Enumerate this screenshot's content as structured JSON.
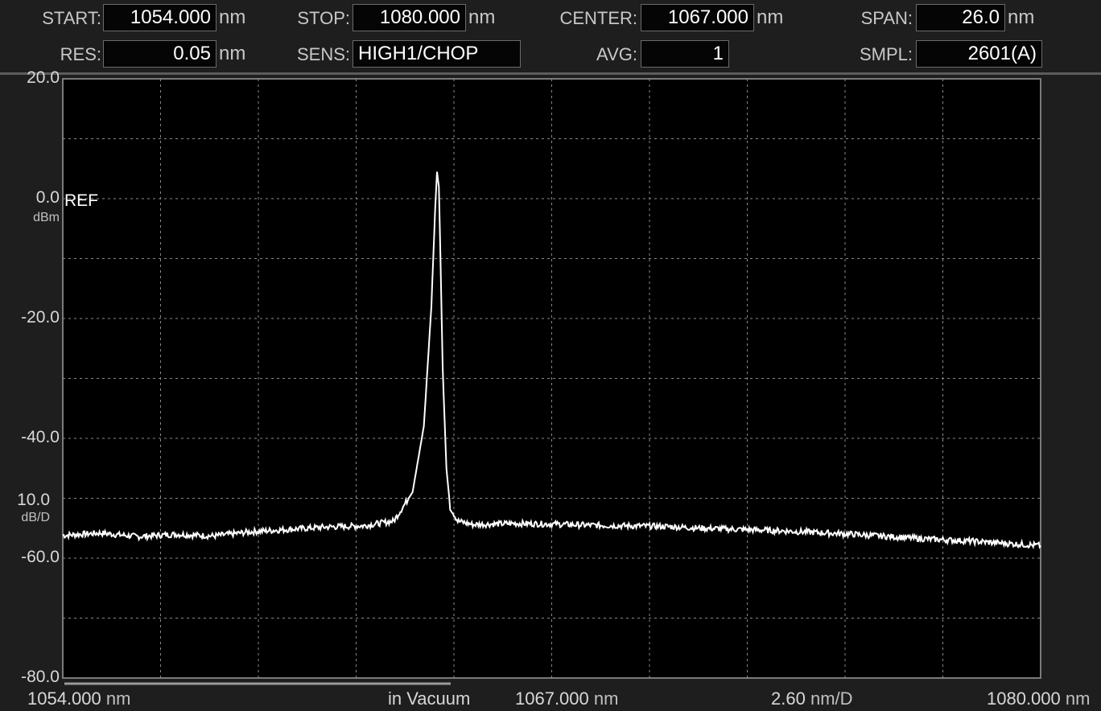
{
  "header": {
    "start": {
      "label": "START:",
      "value": "1054.000",
      "unit": "nm"
    },
    "stop": {
      "label": "STOP:",
      "value": "1080.000",
      "unit": "nm"
    },
    "center": {
      "label": "CENTER:",
      "value": "1067.000",
      "unit": "nm"
    },
    "span": {
      "label": "SPAN:",
      "value": "26.0",
      "unit": "nm"
    },
    "res": {
      "label": "RES:",
      "value": "0.05",
      "unit": "nm"
    },
    "sens": {
      "label": "SENS:",
      "value": "HIGH1/CHOP"
    },
    "avg": {
      "label": "AVG:",
      "value": "1"
    },
    "smpl": {
      "label": "SMPL:",
      "value": "2601(A)"
    }
  },
  "axis": {
    "ref_label": "REF",
    "ref_unit": "dBm",
    "scale_value": "10.0",
    "scale_unit": "dB/D"
  },
  "footer": {
    "start": "1054.000",
    "start_unit": "nm",
    "medium": "in Vacuum",
    "center": "1067.000",
    "center_unit": "nm",
    "per_div": "2.60",
    "per_div_unit": "nm/D",
    "stop": "1080.000",
    "stop_unit": "nm"
  },
  "colors": {
    "trace": "#ffffff",
    "grid": "#8a8a8a",
    "plot_bg": "#000000",
    "frame": "#7a7a7a"
  },
  "chart_data": {
    "type": "line",
    "xlim": [
      1054.0,
      1080.0
    ],
    "ylim": [
      -80.0,
      20.0
    ],
    "y_ticks": [
      "20.0",
      "0.0",
      "-20.0",
      "-40.0",
      "-60.0",
      "-80.0"
    ],
    "grid": true,
    "x": [
      1054.0,
      1055.0,
      1056.0,
      1057.0,
      1058.0,
      1059.0,
      1060.0,
      1061.0,
      1062.0,
      1062.8,
      1063.3,
      1063.6,
      1063.8,
      1063.9,
      1063.95,
      1064.0,
      1064.05,
      1064.1,
      1064.2,
      1064.3,
      1064.5,
      1064.9,
      1066.0,
      1067.0,
      1068.0,
      1069.0,
      1070.0,
      1071.0,
      1072.0,
      1073.0,
      1074.0,
      1075.0,
      1076.0,
      1077.0,
      1078.0,
      1079.0,
      1080.0
    ],
    "y": [
      -56.2,
      -55.8,
      -56.4,
      -56.0,
      -56.3,
      -55.6,
      -55.2,
      -54.8,
      -54.6,
      -53.8,
      -49.0,
      -38.0,
      -18.0,
      -2.0,
      4.5,
      2.0,
      -12.0,
      -28.0,
      -45.0,
      -51.5,
      -53.8,
      -54.4,
      -54.2,
      -54.3,
      -54.5,
      -54.6,
      -54.7,
      -55.0,
      -55.2,
      -55.4,
      -55.7,
      -56.0,
      -56.4,
      -56.8,
      -57.1,
      -57.5,
      -57.9
    ]
  }
}
